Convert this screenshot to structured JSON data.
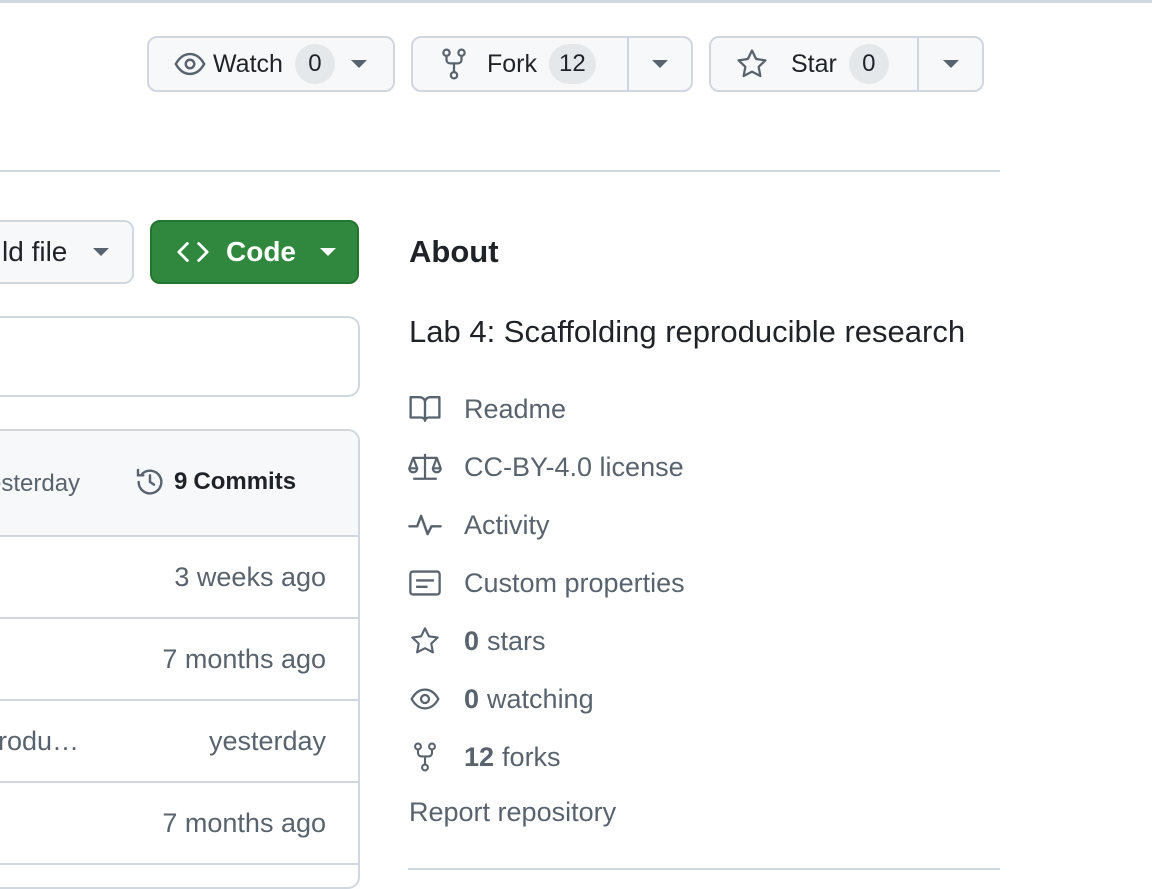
{
  "header": {
    "watch": {
      "label": "Watch",
      "count": "0"
    },
    "fork": {
      "label": "Fork",
      "count": "12"
    },
    "star": {
      "label": "Star",
      "count": "0"
    }
  },
  "toolbar": {
    "add_file_label": "ld file",
    "code_label": "Code"
  },
  "commit_bar": {
    "time": "yesterday",
    "commits_count": "9",
    "commits_label": "Commits"
  },
  "file_rows": [
    {
      "message": "",
      "time": "3 weeks ago"
    },
    {
      "message": "",
      "time": "7 months ago"
    },
    {
      "message": "rodu…",
      "time": "yesterday"
    },
    {
      "message": "",
      "time": "7 months ago"
    }
  ],
  "about": {
    "title": "About",
    "description": "Lab 4: Scaffolding reproducible research",
    "readme": "Readme",
    "license": "CC-BY-4.0 license",
    "activity": "Activity",
    "custom_properties": "Custom properties",
    "stars_count": "0",
    "stars_label": "stars",
    "watching_count": "0",
    "watching_label": "watching",
    "forks_count": "12",
    "forks_label": "forks",
    "report": "Report repository"
  },
  "icons": [
    "eye-icon",
    "repo-forked-icon",
    "star-icon",
    "code-icon",
    "history-icon",
    "book-icon",
    "law-icon",
    "pulse-icon",
    "note-icon"
  ],
  "colors": {
    "code_button": "#2f883d",
    "border": "#d0d7de",
    "muted_text": "#59636e"
  }
}
